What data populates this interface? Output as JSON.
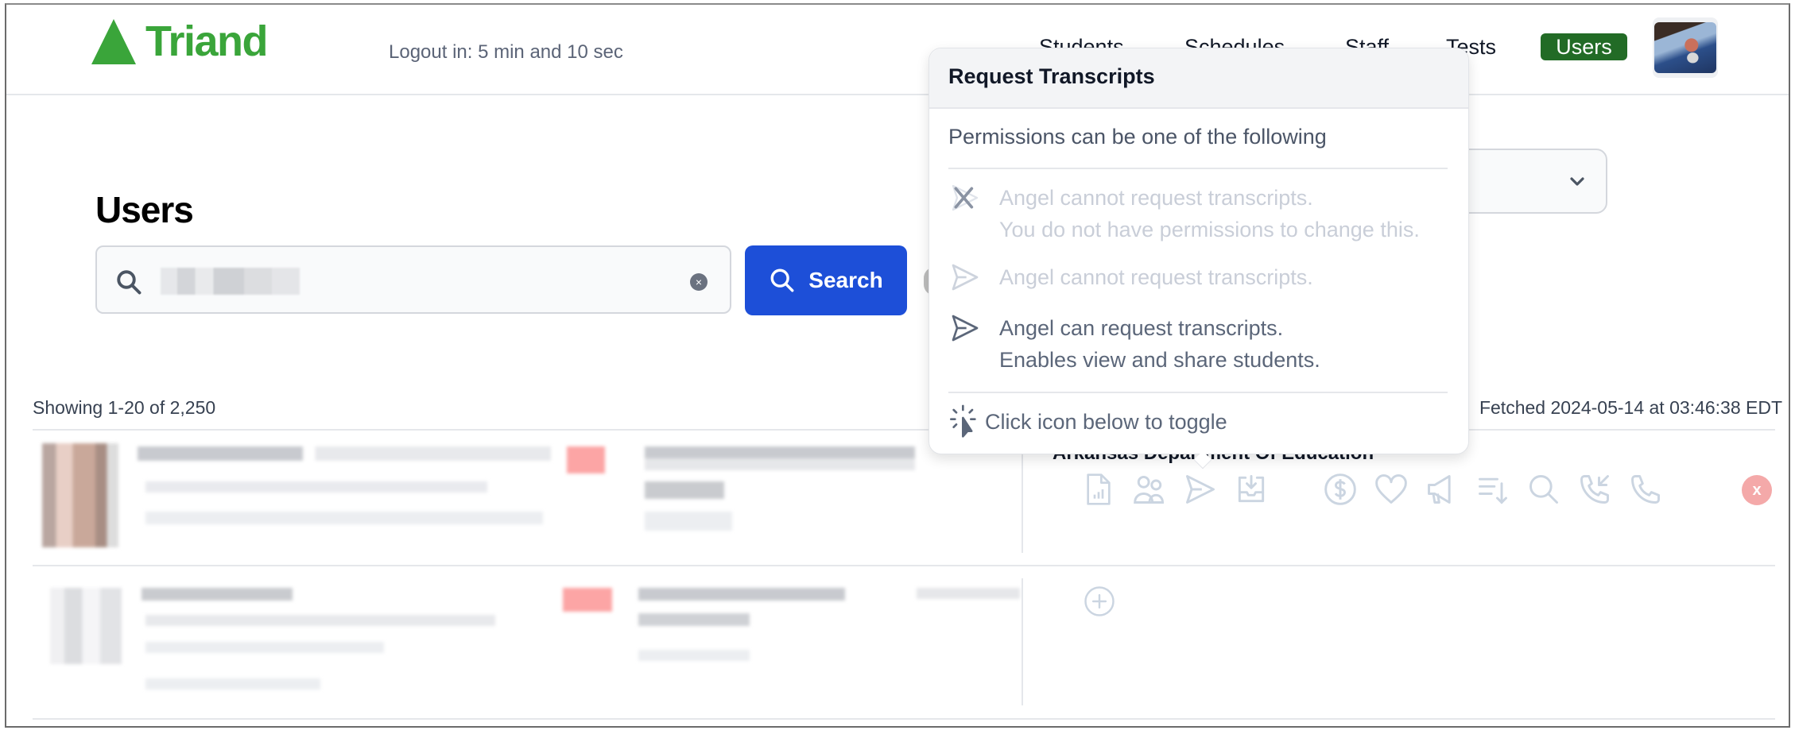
{
  "header": {
    "logo_text": "Triand",
    "logout_timer": "Logout in: 5 min and 10 sec",
    "nav": [
      {
        "label": "Students"
      },
      {
        "label": "Schedules"
      },
      {
        "label": "Staff"
      },
      {
        "label": "Tests"
      },
      {
        "label": "Users",
        "active": true
      }
    ],
    "brand_color": "#3aa53a",
    "active_nav_color": "#226b26"
  },
  "page": {
    "title": "Users",
    "search": {
      "value": "",
      "value_redacted": true,
      "clear_icon": "x-circle-icon",
      "button_label": "Search",
      "button_color": "#1d4fd8"
    },
    "filter_select": {
      "selected": ""
    }
  },
  "results": {
    "showing": "Showing 1-20 of 2,250",
    "fetched": "Fetched 2024-05-14 at 03:46:38 EDT",
    "rows": [
      {
        "redacted": true,
        "organization": "Arkansas Department Of Education",
        "permission_icons": [
          "report-file-icon",
          "users-icon",
          "send-icon",
          "inbox-download-icon",
          "dollar-icon",
          "heart-icon",
          "megaphone-icon",
          "sort-down-icon",
          "search-icon",
          "phone-incoming-icon",
          "phone-icon"
        ],
        "remove_label": "x"
      },
      {
        "redacted": true,
        "organization": "",
        "add_label": "+"
      }
    ]
  },
  "popover": {
    "title": "Request Transcripts",
    "subtitle": "Permissions can be one of the following",
    "options": [
      {
        "icon": "send-disabled-icon",
        "line1": "Angel cannot request transcripts.",
        "line2": "You do not have permissions to change this.",
        "state": "locked"
      },
      {
        "icon": "send-off-icon",
        "line1": "Angel cannot request transcripts.",
        "line2": "",
        "state": "off"
      },
      {
        "icon": "send-icon",
        "line1": "Angel can request transcripts.",
        "line2": "Enables view and share students.",
        "state": "on"
      }
    ],
    "footer": "Click icon below to toggle"
  }
}
